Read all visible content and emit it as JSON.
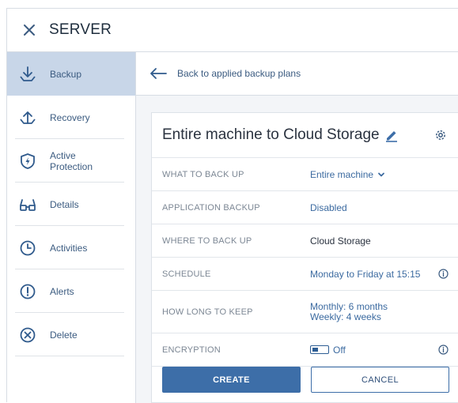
{
  "header": {
    "title": "SERVER",
    "close_icon": "close-icon"
  },
  "sidebar": {
    "items": [
      {
        "label": "Backup",
        "icon": "backup-download-icon",
        "active": true
      },
      {
        "label": "Recovery",
        "icon": "recovery-upload-icon",
        "active": false
      },
      {
        "label": "Active Protection",
        "icon": "shield-icon",
        "active": false
      },
      {
        "label": "Details",
        "icon": "glasses-icon",
        "active": false
      },
      {
        "label": "Activities",
        "icon": "clock-icon",
        "active": false
      },
      {
        "label": "Alerts",
        "icon": "alert-icon",
        "active": false
      },
      {
        "label": "Delete",
        "icon": "delete-x-icon",
        "active": false
      }
    ]
  },
  "main": {
    "back_label": "Back to applied backup plans",
    "plan": {
      "title": "Entire machine to Cloud Storage",
      "rows": [
        {
          "label": "WHAT TO BACK UP",
          "value": "Entire machine"
        },
        {
          "label": "APPLICATION BACKUP",
          "value": "Disabled"
        },
        {
          "label": "WHERE TO BACK UP",
          "value": "Cloud Storage"
        },
        {
          "label": "SCHEDULE",
          "value": "Monday to Friday at 15:15"
        },
        {
          "label": "HOW LONG TO KEEP",
          "value_line1": "Monthly: 6 months",
          "value_line2": "Weekly: 4 weeks"
        },
        {
          "label": "ENCRYPTION",
          "value": "Off"
        }
      ]
    },
    "create_label": "CREATE",
    "cancel_label": "CANCEL"
  },
  "colors": {
    "accent": "#3d6ea8",
    "link": "#3b6aa0",
    "active_nav": "#c8d6e8",
    "background": "#f3f5f8"
  }
}
